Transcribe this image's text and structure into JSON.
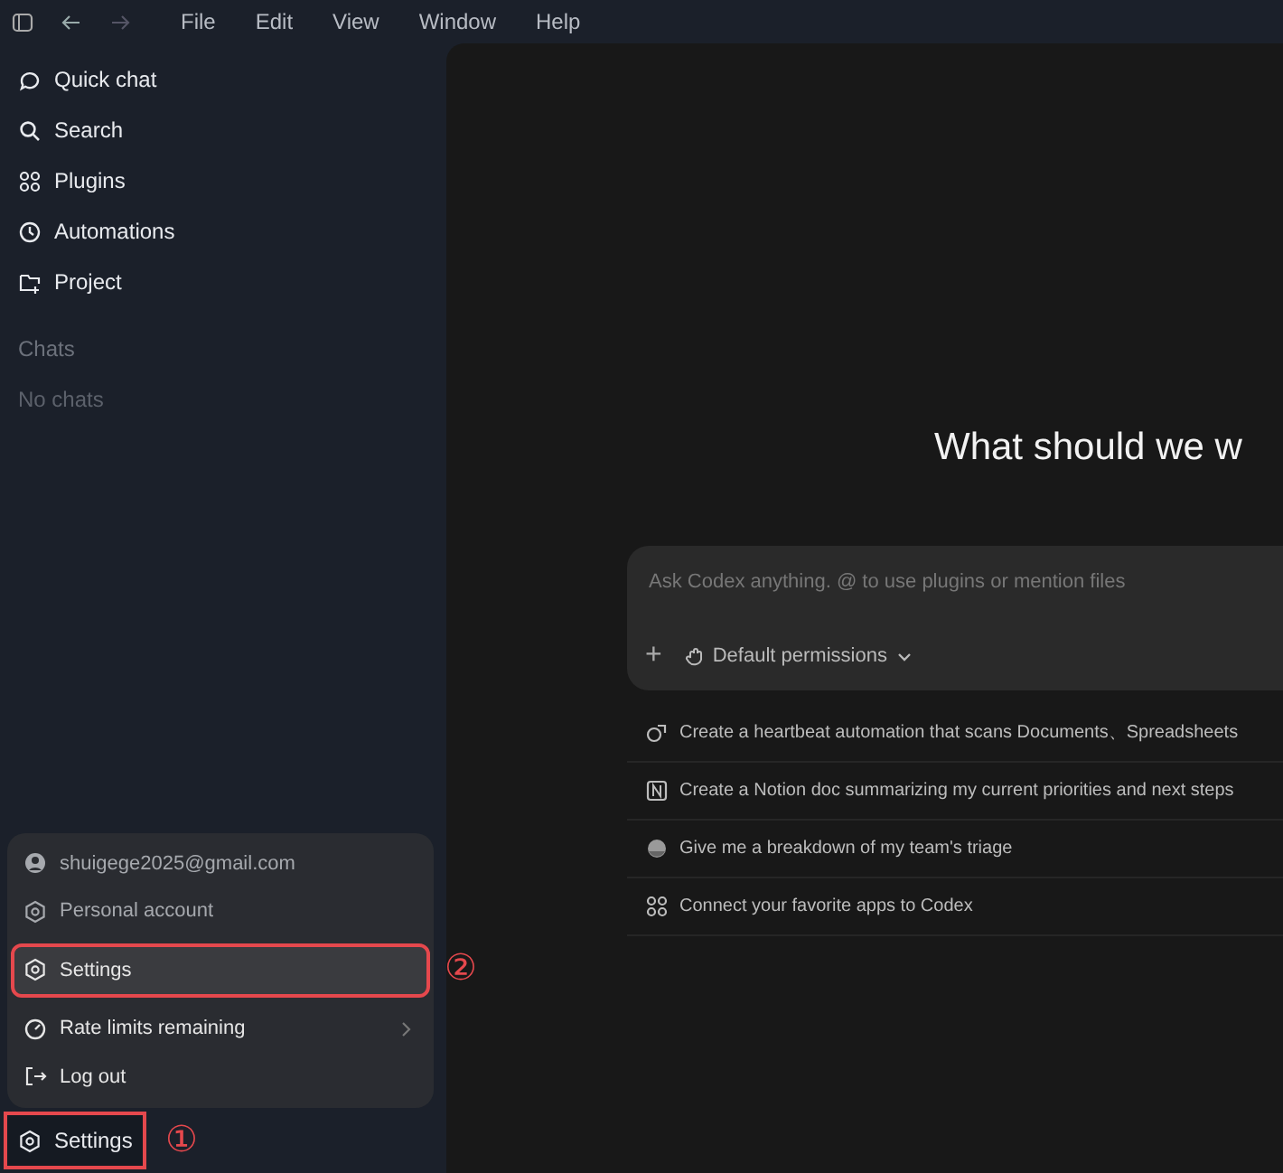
{
  "menu_bar": {
    "items": [
      "File",
      "Edit",
      "View",
      "Window",
      "Help"
    ]
  },
  "sidebar": {
    "nav": [
      {
        "label": "Quick chat"
      },
      {
        "label": "Search"
      },
      {
        "label": "Plugins"
      },
      {
        "label": "Automations"
      },
      {
        "label": "Project"
      }
    ],
    "section_title": "Chats",
    "empty_text": "No chats",
    "account_menu": {
      "items": [
        {
          "kind": "info",
          "label": "shuigege2025@gmail.com",
          "highlighted": false
        },
        {
          "kind": "info",
          "label": "Personal account",
          "highlighted": false
        },
        {
          "kind": "action",
          "label": "Settings",
          "highlighted": true,
          "annotation": "②"
        },
        {
          "kind": "submenu",
          "label": "Rate limits remaining",
          "highlighted": false
        },
        {
          "kind": "action",
          "label": "Log out",
          "highlighted": false
        }
      ]
    },
    "settings_button": {
      "label": "Settings",
      "highlighted": true,
      "annotation": "①"
    }
  },
  "main": {
    "heading": "What should we w",
    "composer": {
      "add_button": "+",
      "placeholder": "Ask Codex anything. @ to use plugins or mention files",
      "permissions": "Default permissions"
    },
    "suggestions": [
      {
        "text": "Create a heartbeat automation that scans Documents、Spreadsheets"
      },
      {
        "text": "Create a Notion doc summarizing my current priorities and next steps"
      },
      {
        "text": "Give me a breakdown of my team's triage"
      },
      {
        "text": "Connect your favorite apps to Codex"
      }
    ]
  }
}
